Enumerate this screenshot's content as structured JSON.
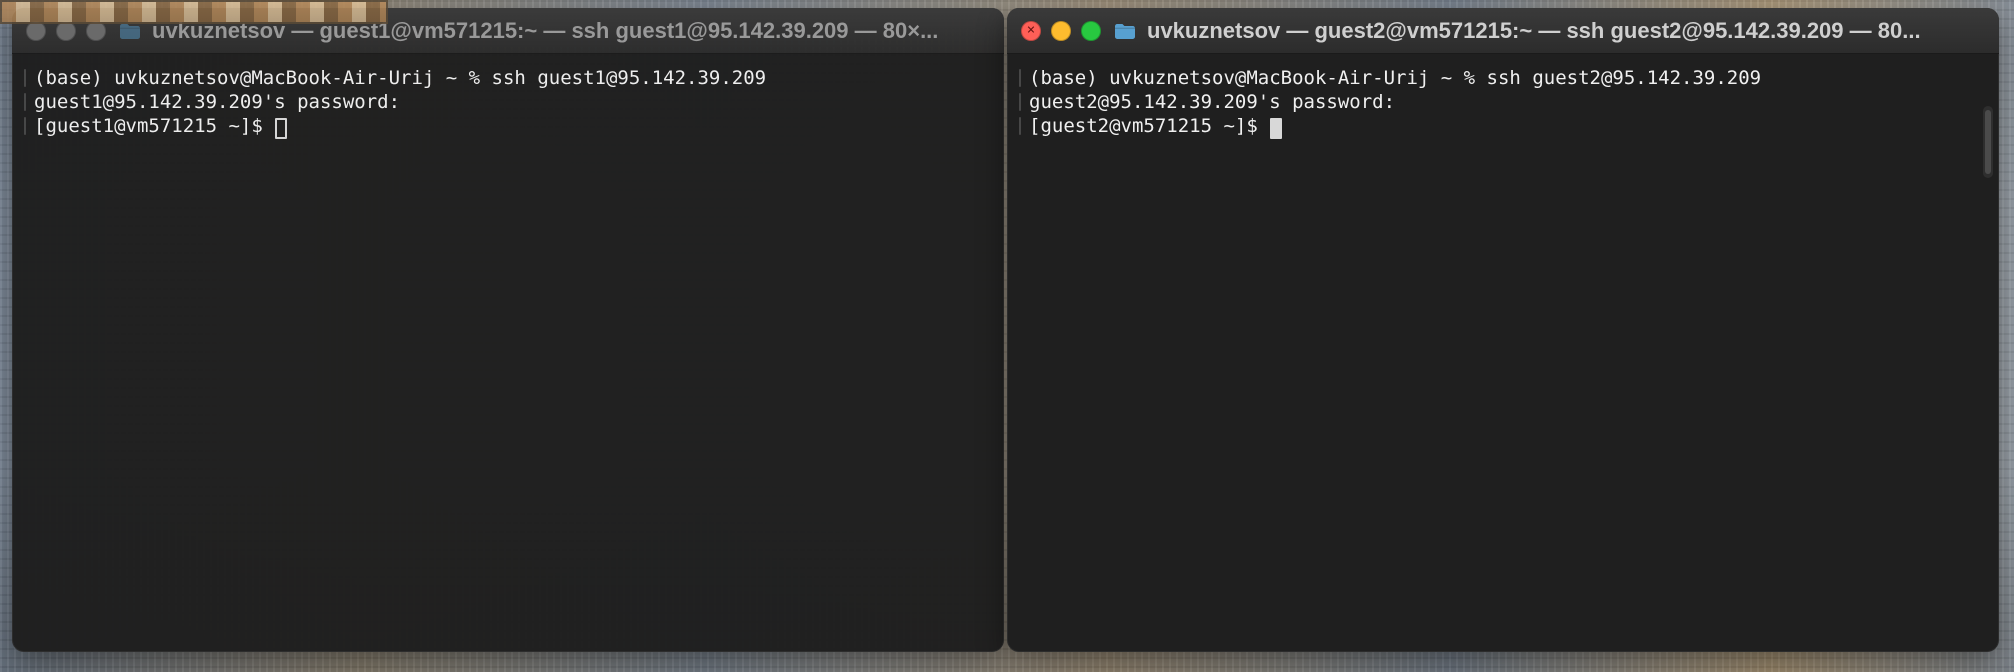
{
  "windows": [
    {
      "title": "uvkuznetsov — guest1@vm571215:~ — ssh guest1@95.142.39.209 — 80×...",
      "lines": [
        "(base) uvkuznetsov@MacBook-Air-Urij ~ % ssh guest1@95.142.39.209",
        "guest1@95.142.39.209's password:"
      ],
      "prompt": "[guest1@vm571215 ~]$",
      "cursor": "hollow",
      "active": false
    },
    {
      "title": "uvkuznetsov — guest2@vm571215:~ — ssh guest2@95.142.39.209 — 80...",
      "lines": [
        "(base) uvkuznetsov@MacBook-Air-Urij ~ % ssh guest2@95.142.39.209",
        "guest2@95.142.39.209's password:"
      ],
      "prompt": "[guest2@vm571215 ~]$",
      "cursor": "filled",
      "active": true
    }
  ],
  "colors": {
    "terminal_bg": "#1f1f1f",
    "terminal_text": "#f0f0f0",
    "close": "#ff5f57",
    "minimize": "#febc2e",
    "zoom": "#28c840"
  },
  "icons": {
    "window_folder": "folder-icon",
    "close": "close-icon",
    "minimize": "minimize-icon",
    "zoom": "zoom-icon"
  }
}
